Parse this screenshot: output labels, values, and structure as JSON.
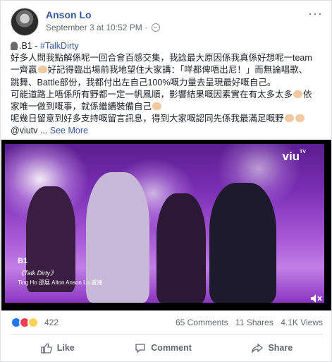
{
  "post": {
    "author": "Anson Lo",
    "timestamp": "September 3 at 10:52 PM",
    "more_icon": "more-dots-icon",
    "privacy_icon": "globe-icon",
    "text": {
      "l1_prefix": ".B1 - ",
      "l1_hashtag": "#TalkDirty",
      "l2": "好多人問我點解係呢一回合會百感交集，我諗最大原因係我真係好想呢一team",
      "l3a": "一齊贏",
      "l3b": "好記得臨出場前我地望住大家講：「咩都俾唔出尼！」而無論唱歌、",
      "l4": "跳舞、Battle部份，我都付出左自己100%嘅力量去呈現最好嘅自己。",
      "l5a": "可能道路上唔係所有野都一定一帆風順，影響結果嘅因素實在有太多太多",
      "l5b": "依",
      "l6a": "家唯一做到嘅事，就係繼續裝備自己",
      "l7a": "呢幾日留意到好多支持嘅留言訊息，得到大家嘅認同先係我最滿足嘅野",
      "l8_prefix": "@viutv ... ",
      "see_more": "See More"
    },
    "video": {
      "logo": "viu",
      "logo_sup": "TV",
      "segment": "B1",
      "song": "《Talk Dirty》",
      "performers": "Ting Ho 邵展 Alton Anson Lo 盧瀚",
      "mute_icon": "speaker-mute-icon"
    },
    "stats": {
      "reaction_count": "422",
      "comments": "65 Comments",
      "shares": "11 Shares",
      "views": "4.1K Views"
    },
    "actions": {
      "like": "Like",
      "comment": "Comment",
      "share": "Share"
    },
    "colors": {
      "link": "#365899",
      "like_blue": "#2078f4",
      "love_red": "#f33e58",
      "haha_yellow": "#fcd155"
    }
  }
}
